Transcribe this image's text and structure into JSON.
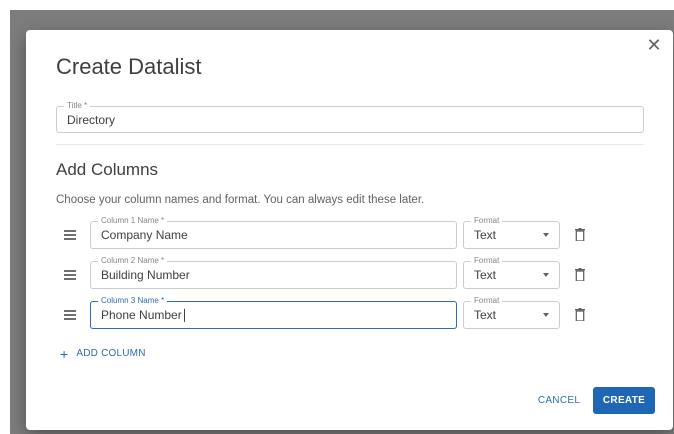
{
  "dialog": {
    "title": "Create Datalist",
    "close_icon": "close-icon",
    "title_field": {
      "label": "Title *",
      "value": "Directory"
    },
    "section_title": "Add Columns",
    "section_description": "Choose your column names and format. You can always edit these later.",
    "columns": [
      {
        "label": "Column 1 Name *",
        "value": "Company Name",
        "format_label": "Format",
        "format": "Text"
      },
      {
        "label": "Column 2 Name *",
        "value": "Building Number",
        "format_label": "Format",
        "format": "Text"
      },
      {
        "label": "Column 3 Name *",
        "value": "Phone Number",
        "format_label": "Format",
        "format": "Text"
      }
    ],
    "add_column_label": "ADD COLUMN",
    "cancel_label": "CANCEL",
    "create_label": "CREATE"
  },
  "colors": {
    "accent": "#1f66b5",
    "focus_border": "#2d6db3",
    "backdrop": "#7d7d7d"
  }
}
